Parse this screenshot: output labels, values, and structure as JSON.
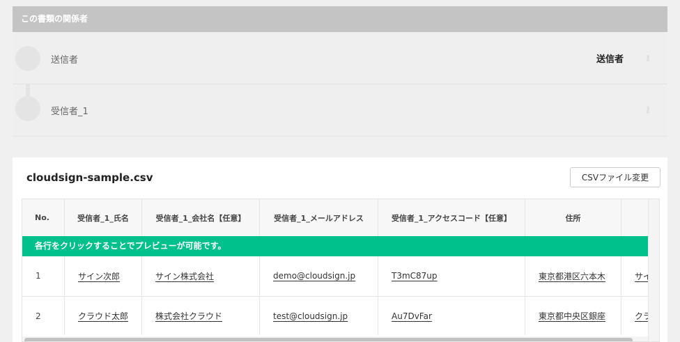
{
  "relations": {
    "title": "この書類の関係者",
    "rows": [
      {
        "name": "送信者",
        "role": "送信者",
        "icon": "key-icon"
      },
      {
        "name": "受信者_1",
        "role": "",
        "icon": "key-icon"
      }
    ]
  },
  "csv": {
    "filename": "cloudsign-sample.csv",
    "change_button": "CSVファイル変更",
    "headers": [
      "No.",
      "受信者_1_氏名",
      "受信者_1_会社名【任意】",
      "受信者_1_メールアドレス",
      "受信者_1_アクセスコード【任意】",
      "住所",
      ""
    ],
    "hint": "各行をクリックすることでプレビューが可能です。",
    "rows": [
      [
        "1",
        "サイン次郎",
        "サイン株式会社",
        "demo@cloudsign.jp",
        "T3mC87up",
        "東京都港区六本木",
        "サイ"
      ],
      [
        "2",
        "クラウド太郎",
        "株式会社クラウド",
        "test@cloudsign.jp",
        "Au7DvFar",
        "東京都中央区銀座",
        "クラ"
      ]
    ]
  },
  "colors": {
    "hint_bar": "#00c08b",
    "header_bar": "#c4c4c4"
  }
}
